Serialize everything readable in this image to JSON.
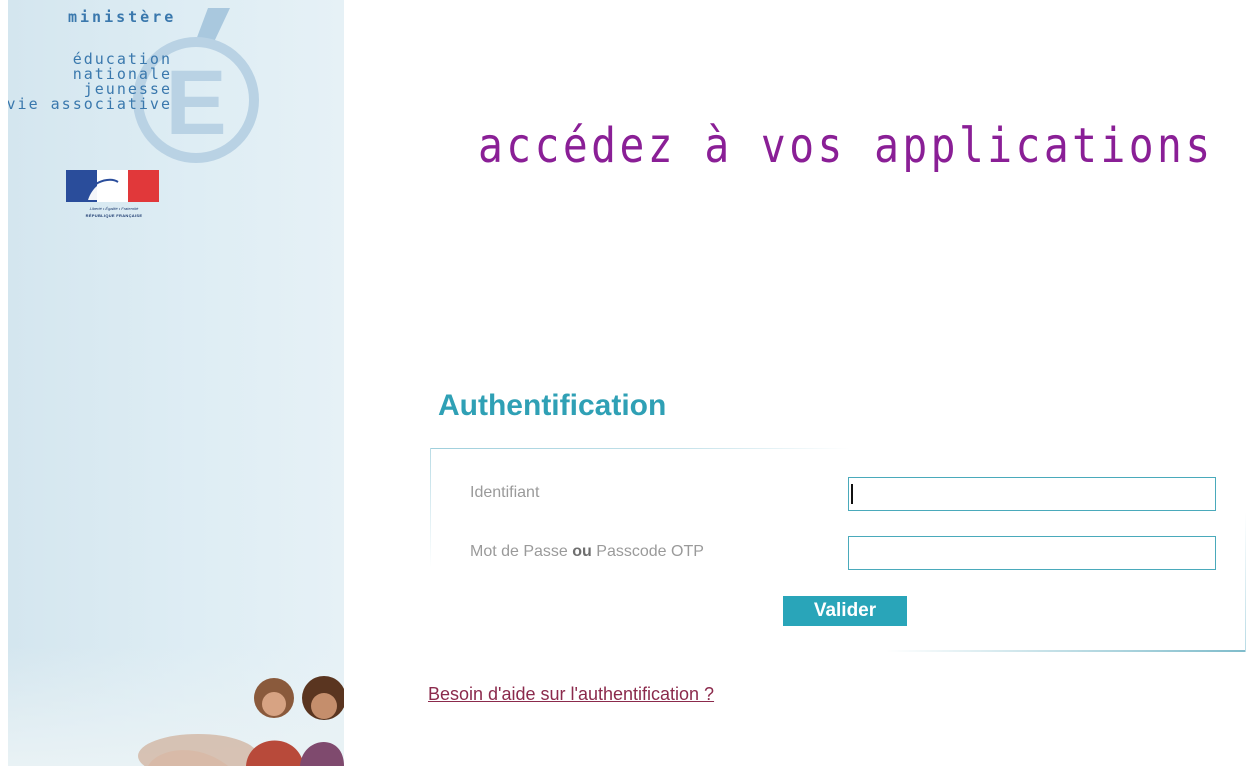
{
  "sidebar": {
    "ministry": {
      "line1": "ministère",
      "lines": [
        "éducation",
        "nationale",
        "jeunesse",
        "vie associative"
      ],
      "emblem_letter": "E"
    },
    "republic_logo": {
      "motto": "Liberté • Égalité • Fraternité",
      "name": "RÉPUBLIQUE FRANÇAISE"
    }
  },
  "main": {
    "headline": "accédez à vos applications",
    "auth_title": "Authentification",
    "form": {
      "identifier_label": "Identifiant",
      "identifier_value": "",
      "password_label_part1": "Mot de Passe",
      "password_label_or": "ou",
      "password_label_part2": "Passcode OTP",
      "password_value": "",
      "submit_label": "Valider"
    },
    "help_link": "Besoin d'aide sur l'authentification ?"
  },
  "colors": {
    "headline": "#8a1f96",
    "auth_title": "#2fa0b5",
    "button": "#29a5b9",
    "help_link": "#8b2a4c",
    "sidebar_bg": "#d9e9f1",
    "ministry_text": "#3a78ad"
  }
}
